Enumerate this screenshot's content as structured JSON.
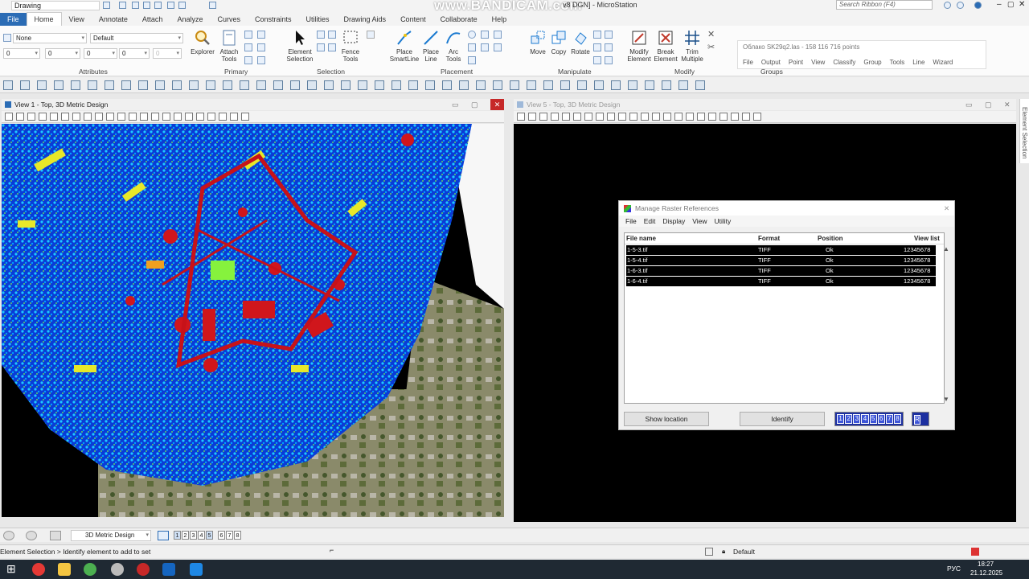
{
  "title_bar": {
    "workspace": "Drawing",
    "window_title": "v8 DGN] - MicroStation",
    "watermark": "www.BANDICAM.com",
    "search_placeholder": "Search Ribbon (F4)"
  },
  "ribbon_tabs": [
    "File",
    "Home",
    "View",
    "Annotate",
    "Attach",
    "Analyze",
    "Curves",
    "Constraints",
    "Utilities",
    "Drawing Aids",
    "Content",
    "Collaborate",
    "Help"
  ],
  "ribbon": {
    "attributes": {
      "level": "None",
      "style": "Default",
      "color": "0",
      "weight": "0",
      "line": "0",
      "trans": "0",
      "label": "Attributes"
    },
    "primary": {
      "explorer": "Explorer",
      "attach_tools": "Attach Tools",
      "label": "Primary"
    },
    "selection": {
      "element_selection": "Element Selection",
      "fence_tools": "Fence Tools",
      "label": "Selection"
    },
    "placement": {
      "place_smartline": "Place SmartLine",
      "place_line": "Place Line",
      "arc_tools": "Arc Tools",
      "label": "Placement"
    },
    "manipulate": {
      "move": "Move",
      "copy": "Copy",
      "rotate": "Rotate",
      "label": "Manipulate"
    },
    "modify": {
      "modify_element": "Modify Element",
      "break_element": "Break Element",
      "trim_multiple": "Trim Multiple",
      "label": "Modify"
    },
    "groups_label": "Groups"
  },
  "pointcloud_popup": {
    "title": "Облако SK29q2.las - 158 116 716 points",
    "menu": [
      "File",
      "Output",
      "Point",
      "View",
      "Classify",
      "Group",
      "Tools",
      "Line",
      "Wizard"
    ]
  },
  "view1": {
    "title": "View 1 - Top, 3D Metric Design"
  },
  "view5": {
    "title": "View 5 - Top, 3D Metric Design"
  },
  "right_panel": {
    "label": "Element Selection"
  },
  "dialog": {
    "title": "Manage Raster References",
    "menu": [
      "File",
      "Edit",
      "Display",
      "View",
      "Utility"
    ],
    "columns": [
      "File name",
      "Format",
      "Position",
      "View list"
    ],
    "rows": [
      {
        "file": "1-5-3.tif",
        "format": "TIFF",
        "position": "Ok",
        "views": "12345678 R"
      },
      {
        "file": "1-5-4.tif",
        "format": "TIFF",
        "position": "Ok",
        "views": "12345678 R"
      },
      {
        "file": "1-6-3.tif",
        "format": "TIFF",
        "position": "Ok",
        "views": "12345678 R"
      },
      {
        "file": "1-6-4.tif",
        "format": "TIFF",
        "position": "Ok",
        "views": "12345678 R"
      }
    ],
    "show_location": "Show location",
    "identify": "Identify",
    "view_digits": [
      "1",
      "2",
      "3",
      "4",
      "5",
      "6",
      "7",
      "8"
    ],
    "r_label": "R"
  },
  "viewbar": {
    "model": "3D Metric Design",
    "views": [
      "1",
      "2",
      "3",
      "4",
      "5",
      "6",
      "7",
      "8"
    ]
  },
  "status": {
    "prompt": "Element Selection > Identify element to add to set",
    "level": "Default"
  },
  "taskbar": {
    "lang": "РУС",
    "time": "18:27",
    "date": "21.12.2025"
  }
}
